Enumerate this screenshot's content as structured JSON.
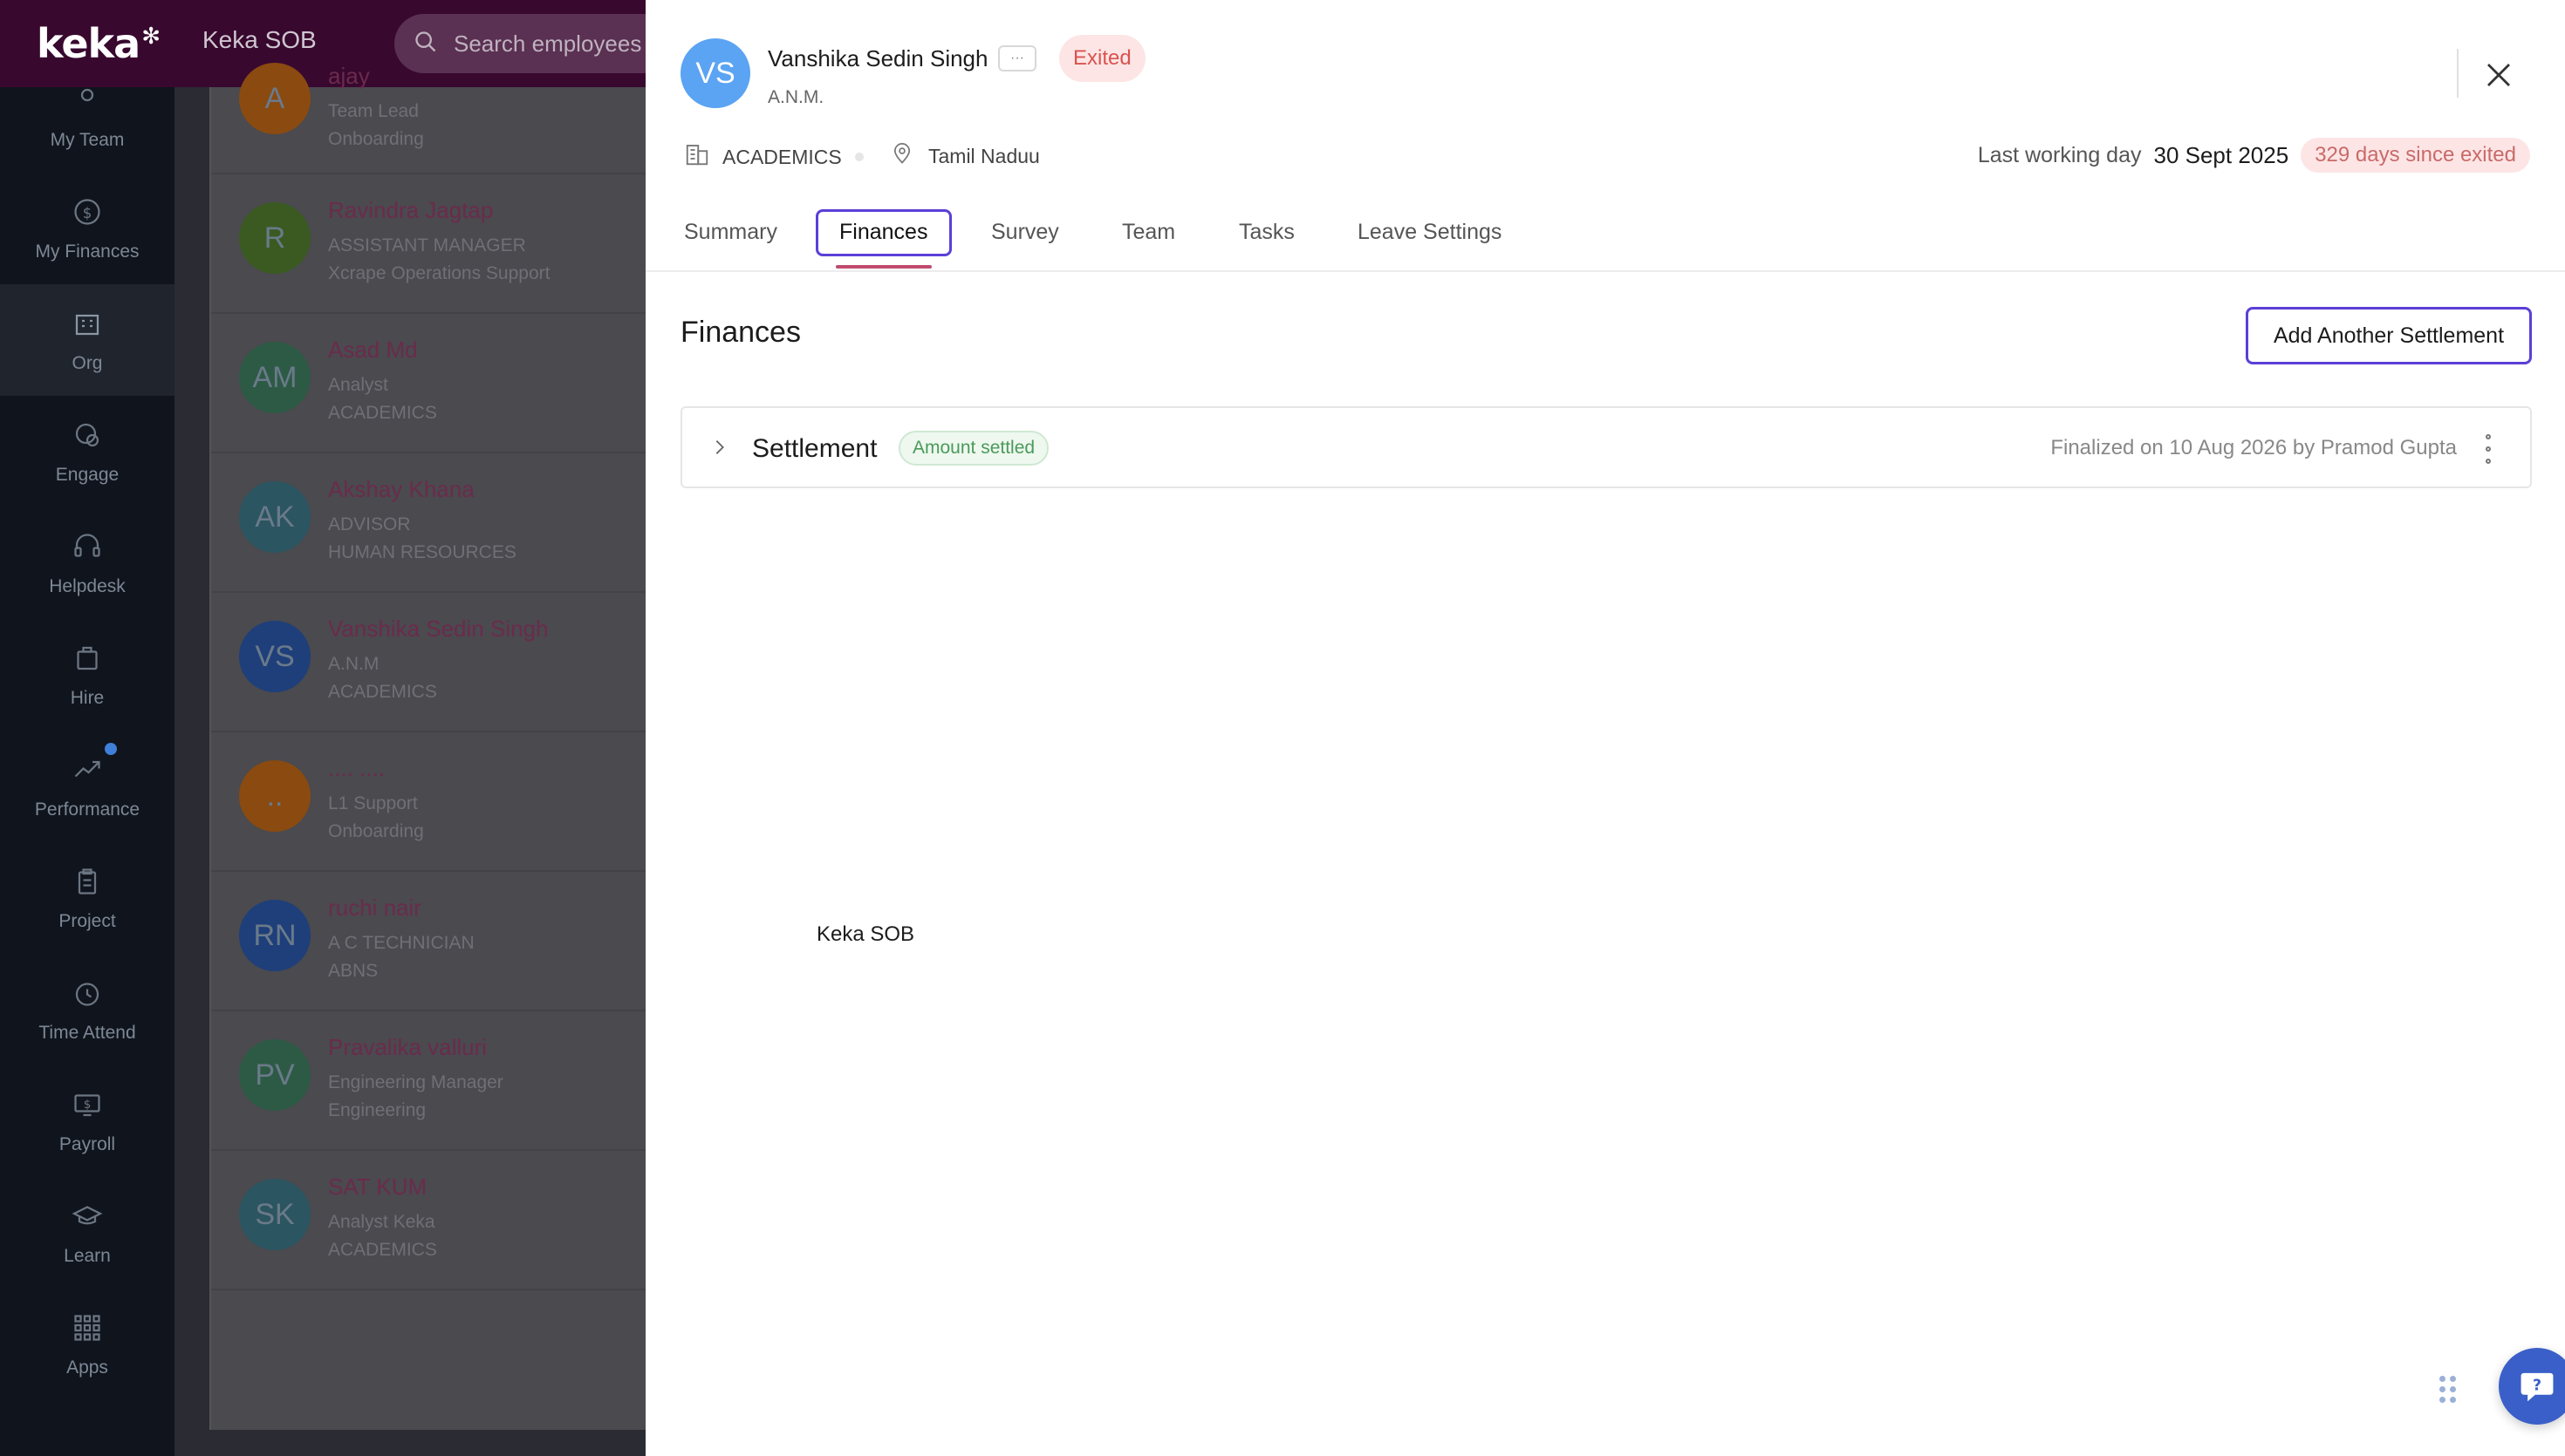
{
  "app": {
    "logo_text": "keka",
    "org_name": "Keka SOB",
    "search_placeholder": "Search employees o"
  },
  "sidebar": {
    "items": [
      {
        "label": "My Team",
        "icon": "team-icon"
      },
      {
        "label": "My Finances",
        "icon": "dollar-icon"
      },
      {
        "label": "Org",
        "icon": "building-icon",
        "active": true
      },
      {
        "label": "Engage",
        "icon": "engage-icon"
      },
      {
        "label": "Helpdesk",
        "icon": "headset-icon"
      },
      {
        "label": "Hire",
        "icon": "briefcase-icon",
        "notification": true
      },
      {
        "label": "Performance",
        "icon": "trend-icon"
      },
      {
        "label": "Project",
        "icon": "clipboard-icon"
      },
      {
        "label": "Time Attend",
        "icon": "clock-icon"
      },
      {
        "label": "Payroll",
        "icon": "monitor-dollar-icon"
      },
      {
        "label": "Learn",
        "icon": "graduation-cap-icon"
      },
      {
        "label": "Apps",
        "icon": "apps-grid-icon"
      }
    ]
  },
  "employees": [
    {
      "initials": "A",
      "name": "ajay",
      "role": "Team Lead",
      "dept": "Onboarding",
      "color": "#8a4a10"
    },
    {
      "initials": "R",
      "name": "Ravindra Jagtap",
      "role": "ASSISTANT MANAGER",
      "dept": "Xcrape Operations Support",
      "color": "#3a5a22"
    },
    {
      "initials": "AM",
      "name": "Asad Md",
      "role": "Analyst",
      "dept": "ACADEMICS",
      "color": "#2d5a44"
    },
    {
      "initials": "AK",
      "name": "Akshay Khana",
      "role": "ADVISOR",
      "dept": "HUMAN RESOURCES",
      "color": "#2b5560"
    },
    {
      "initials": "VS",
      "name": "Vanshika Sedin Singh",
      "role": "A.N.M",
      "dept": "ACADEMICS",
      "color": "#1e3f7a"
    },
    {
      "initials": "..",
      "name": ".... ....",
      "role": "L1 Support",
      "dept": "Onboarding",
      "color": "#8a4a10"
    },
    {
      "initials": "RN",
      "name": "ruchi nair",
      "role": "A C TECHNICIAN",
      "dept": "ABNS",
      "color": "#1e3f7a"
    },
    {
      "initials": "PV",
      "name": "Pravalika valluri",
      "role": "Engineering Manager",
      "dept": "Engineering",
      "color": "#2d5a44"
    },
    {
      "initials": "SK",
      "name": "SAT KUM",
      "role": "Analyst Keka",
      "dept": "ACADEMICS",
      "color": "#2b5560"
    }
  ],
  "drawer": {
    "avatar_initials": "VS",
    "name": "Vanshika Sedin Singh",
    "more_label": "···",
    "status": "Exited",
    "role": "A.N.M.",
    "department": "ACADEMICS",
    "location": "Tamil Naduu",
    "last_working_day_label": "Last working day",
    "last_working_day": "30 Sept 2025",
    "days_since_exit": "329 days since exited",
    "tabs": [
      "Summary",
      "Finances",
      "Survey",
      "Team",
      "Tasks",
      "Leave Settings"
    ],
    "active_tab": "Finances",
    "section_title": "Finances",
    "add_button": "Add Another Settlement",
    "settlement": {
      "title": "Settlement",
      "status": "Amount settled",
      "finalized": "Finalized on 10 Aug 2026 by Pramod Gupta"
    },
    "floating_label": "Keka SOB",
    "help_label": "?"
  },
  "colors": {
    "topbar": "#38082f",
    "accent_focus": "#5b3fd8",
    "tab_underline": "#c04b6d",
    "exited_badge": "#fde5e5",
    "settled_badge": "#eef8ef",
    "avatar": "#5ba3f3",
    "help_button": "#3a5fc8"
  }
}
